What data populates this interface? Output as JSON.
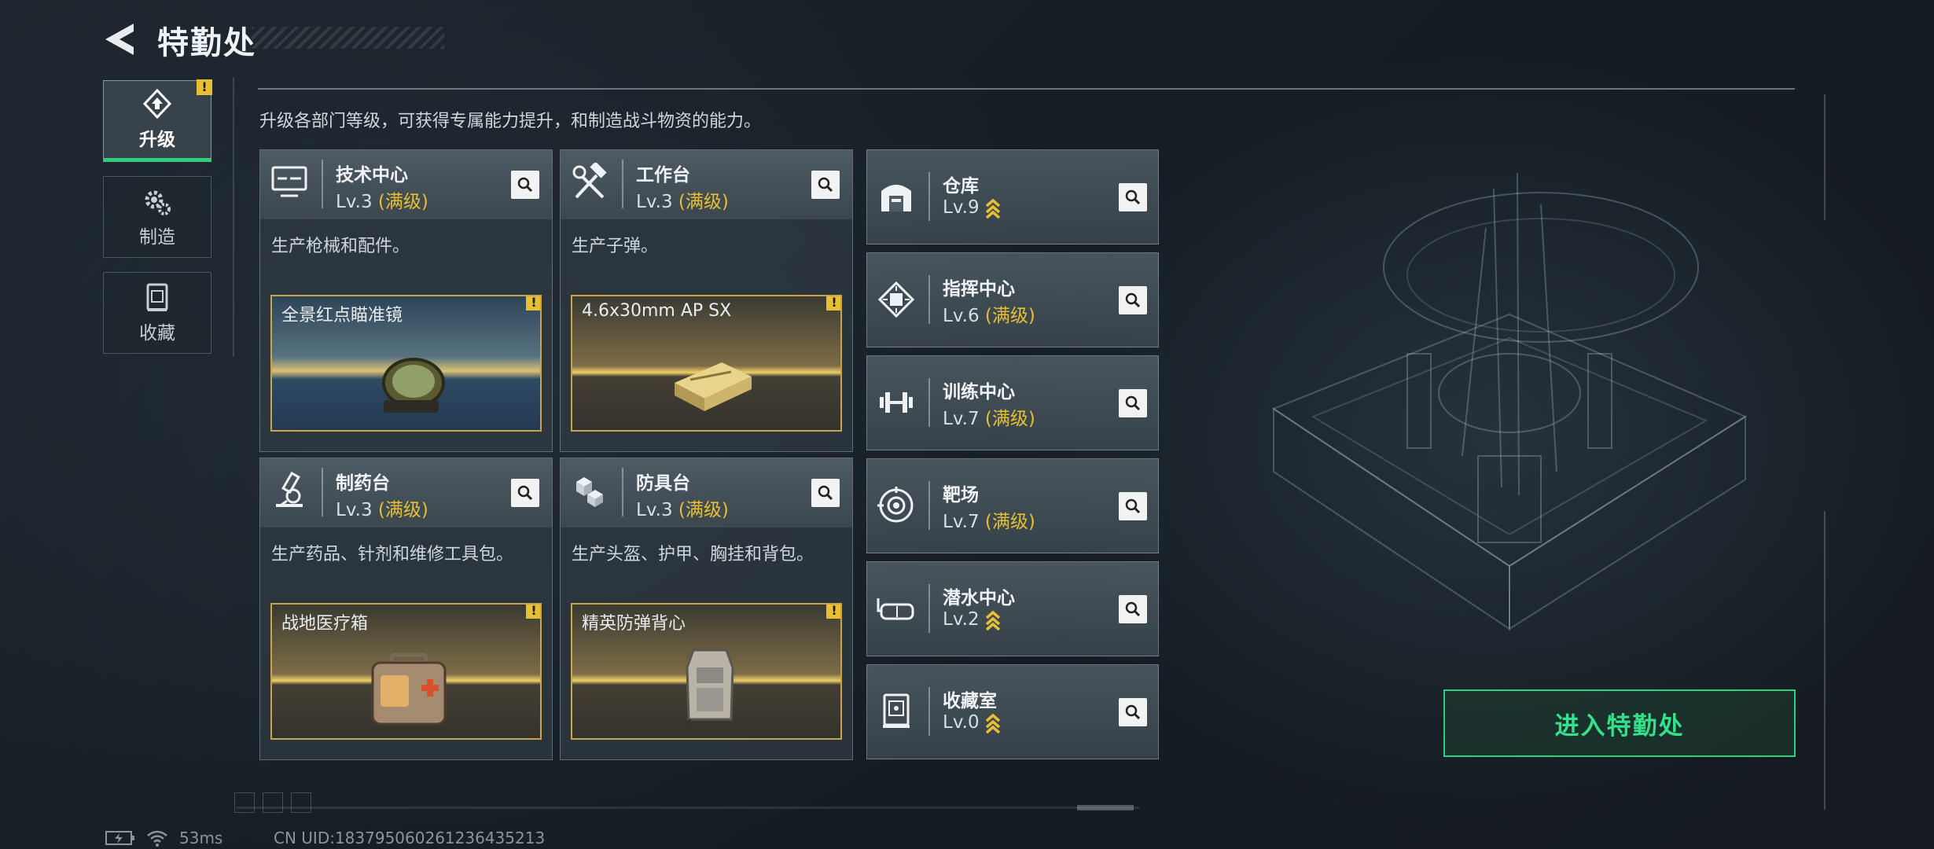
{
  "header": {
    "title": "特勤处"
  },
  "nav": [
    {
      "label": "升级",
      "icon": "upgrade-icon",
      "active": true,
      "warning": "!"
    },
    {
      "label": "制造",
      "icon": "gears-icon",
      "active": false
    },
    {
      "label": "收藏",
      "icon": "collection-icon",
      "active": false
    }
  ],
  "description": "升级各部门等级，可获得专属能力提升，和制造战斗物资的能力。",
  "departments": [
    {
      "name": "技术中心",
      "level": "Lv.3",
      "max": "(满级)",
      "text": "生产枪械和配件。",
      "preview": "全景红点瞄准镜",
      "warning": "!",
      "icon": "monitor-icon"
    },
    {
      "name": "工作台",
      "level": "Lv.3",
      "max": "(满级)",
      "text": "生产子弹。",
      "preview": "4.6x30mm AP SX",
      "warning": "!",
      "icon": "tools-icon"
    },
    {
      "name": "制药台",
      "level": "Lv.3",
      "max": "(满级)",
      "text": "生产药品、针剂和维修工具包。",
      "preview": "战地医疗箱",
      "warning": "!",
      "icon": "microscope-icon"
    },
    {
      "name": "防具台",
      "level": "Lv.3",
      "max": "(满级)",
      "text": "生产头盔、护甲、胸挂和背包。",
      "preview": "精英防弹背心",
      "warning": "!",
      "icon": "boxes-icon"
    }
  ],
  "facilities": [
    {
      "name": "仓库",
      "level": "Lv.9",
      "max": "",
      "upgradable": true,
      "icon": "warehouse-icon"
    },
    {
      "name": "指挥中心",
      "level": "Lv.6",
      "max": "(满级)",
      "upgradable": false,
      "icon": "chip-icon"
    },
    {
      "name": "训练中心",
      "level": "Lv.7",
      "max": "(满级)",
      "upgradable": false,
      "icon": "dumbbell-icon"
    },
    {
      "name": "靶场",
      "level": "Lv.7",
      "max": "(满级)",
      "upgradable": false,
      "icon": "target-icon"
    },
    {
      "name": "潜水中心",
      "level": "Lv.2",
      "max": "",
      "upgradable": true,
      "icon": "goggles-icon"
    },
    {
      "name": "收藏室",
      "level": "Lv.0",
      "max": "",
      "upgradable": true,
      "icon": "collection-room-icon"
    }
  ],
  "enter_button": "进入特勤处",
  "footer": {
    "ping": "53ms",
    "uid": "CN UID:183795060261236435213"
  },
  "colors": {
    "accent_green": "#2fcf7b",
    "gold": "#e6bf33"
  }
}
